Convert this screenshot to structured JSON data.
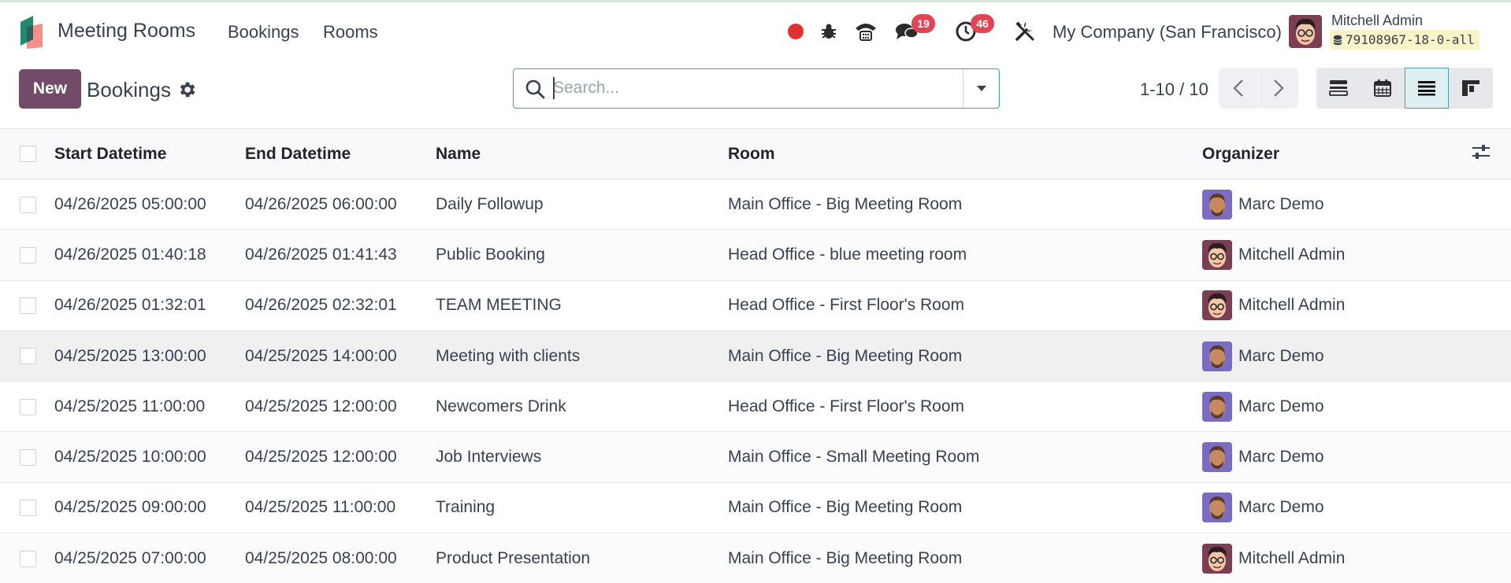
{
  "navbar": {
    "app_name": "Meeting Rooms",
    "menu": [
      "Bookings",
      "Rooms"
    ],
    "messages_count": "19",
    "activities_count": "46",
    "company": "My Company (San Francisco)",
    "user_name": "Mitchell Admin",
    "db_name": "79108967-18-0-all",
    "icons": [
      "record-icon",
      "bug-icon",
      "phone-icon",
      "chat-icon",
      "clock-icon",
      "tools-icon"
    ]
  },
  "control_panel": {
    "new_label": "New",
    "title": "Bookings",
    "search_placeholder": "Search...",
    "pager": "1-10 / 10"
  },
  "table": {
    "columns": [
      "Start Datetime",
      "End Datetime",
      "Name",
      "Room",
      "Organizer"
    ],
    "rows": [
      {
        "start": "04/26/2025 05:00:00",
        "end": "04/26/2025 06:00:00",
        "name": "Daily Followup",
        "room": "Main Office - Big Meeting Room",
        "organizer": "Marc Demo"
      },
      {
        "start": "04/26/2025 01:40:18",
        "end": "04/26/2025 01:41:43",
        "name": "Public Booking",
        "room": "Head Office - blue meeting room",
        "organizer": "Mitchell Admin"
      },
      {
        "start": "04/26/2025 01:32:01",
        "end": "04/26/2025 02:32:01",
        "name": "TEAM MEETING",
        "room": "Head Office - First Floor's Room",
        "organizer": "Mitchell Admin"
      },
      {
        "start": "04/25/2025 13:00:00",
        "end": "04/25/2025 14:00:00",
        "name": "Meeting with clients",
        "room": "Main Office - Big Meeting Room",
        "organizer": "Marc Demo"
      },
      {
        "start": "04/25/2025 11:00:00",
        "end": "04/25/2025 12:00:00",
        "name": "Newcomers Drink",
        "room": "Head Office - First Floor's Room",
        "organizer": "Marc Demo"
      },
      {
        "start": "04/25/2025 10:00:00",
        "end": "04/25/2025 12:00:00",
        "name": "Job Interviews",
        "room": "Main Office - Small Meeting Room",
        "organizer": "Marc Demo"
      },
      {
        "start": "04/25/2025 09:00:00",
        "end": "04/25/2025 11:00:00",
        "name": "Training",
        "room": "Main Office - Big Meeting Room",
        "organizer": "Marc Demo"
      },
      {
        "start": "04/25/2025 07:00:00",
        "end": "04/25/2025 08:00:00",
        "name": "Product Presentation",
        "room": "Main Office - Big Meeting Room",
        "organizer": "Mitchell Admin"
      }
    ]
  },
  "colors": {
    "primary": "#714b67",
    "badge": "#e04555",
    "accent": "#4d9ba6"
  }
}
